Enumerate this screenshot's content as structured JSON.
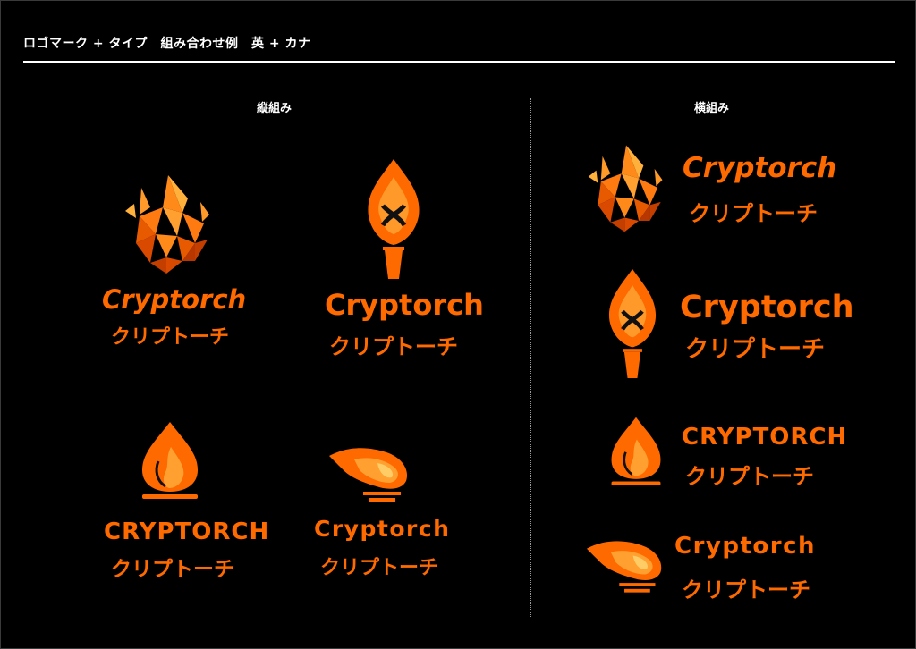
{
  "header": {
    "title": "ロゴマーク + タイプ　組み合わせ例　英 + カナ"
  },
  "columns": {
    "vertical_label": "縦組み",
    "horizontal_label": "横組み"
  },
  "brand": {
    "name_en_mixed": "Cryptorch",
    "name_en_caps": "CRYPTORCH",
    "name_kana": "クリプトーチ"
  },
  "colors": {
    "background": "#000000",
    "accent_orange": "#ff6a00",
    "accent_deep": "#e03a00",
    "accent_light": "#ffa030"
  },
  "icons": [
    "poly-flame-icon",
    "torch-icon",
    "drop-flame-icon",
    "wind-flame-icon"
  ]
}
